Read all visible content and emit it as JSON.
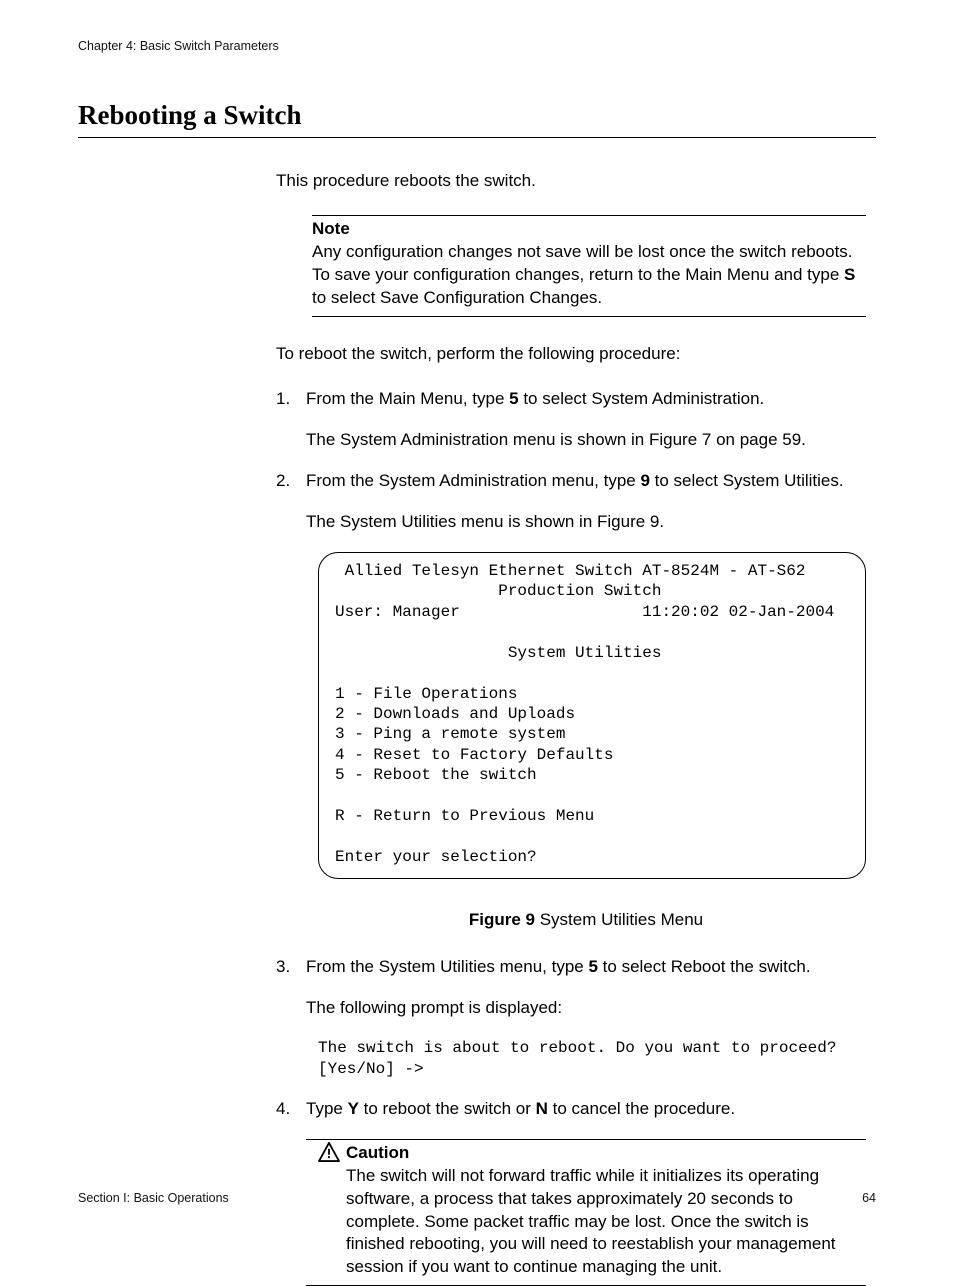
{
  "header": {
    "chapter": "Chapter 4: Basic Switch Parameters"
  },
  "title": "Rebooting a Switch",
  "intro": "This procedure reboots the switch.",
  "note": {
    "label": "Note",
    "line1": "Any configuration changes not save will be lost once the switch reboots. To save your configuration changes, return to the Main Menu and type ",
    "bold": "S",
    "line2": " to select Save Configuration Changes."
  },
  "lead": "To reboot the switch, perform the following procedure:",
  "step1": {
    "num": "1.",
    "pre": "From the Main Menu, type ",
    "bold": "5",
    "post": " to select System Administration.",
    "sub": "The System Administration menu is shown in Figure 7 on page 59."
  },
  "step2": {
    "num": "2.",
    "pre": "From the System Administration menu, type ",
    "bold": "9",
    "post": " to select System Utilities.",
    "sub": "The System Utilities menu is shown in Figure 9."
  },
  "terminal": {
    "l1": " Allied Telesyn Ethernet Switch AT-8524M - AT-S62",
    "l2": "                 Production Switch",
    "l3": "User: Manager                   11:20:02 02-Jan-2004",
    "l4": "",
    "l5": "                  System Utilities",
    "l6": "",
    "l7": "1 - File Operations",
    "l8": "2 - Downloads and Uploads",
    "l9": "3 - Ping a remote system",
    "l10": "4 - Reset to Factory Defaults",
    "l11": "5 - Reboot the switch",
    "l12": "",
    "l13": "R - Return to Previous Menu",
    "l14": "",
    "l15": "Enter your selection?"
  },
  "figure": {
    "label": "Figure 9",
    "caption": "  System Utilities Menu"
  },
  "step3": {
    "num": "3.",
    "pre": "From the System Utilities menu, type ",
    "bold": "5",
    "post": " to select Reboot the switch.",
    "sub": "The following prompt is displayed:"
  },
  "prompt": "The switch is about to reboot. Do you want to proceed? [Yes/No] ->",
  "step4": {
    "num": "4.",
    "pre": "Type ",
    "bold1": "Y",
    "mid": " to reboot the switch or ",
    "bold2": "N",
    "post": " to cancel the procedure."
  },
  "caution": {
    "label": "Caution",
    "text": "The switch will not forward traffic while it initializes its operating software, a process that takes approximately 20 seconds to complete. Some packet traffic may be lost. Once the switch is finished rebooting, you will need to reestablish your management session if you want to continue managing the unit."
  },
  "footer": {
    "left": "Section I: Basic Operations",
    "right": "64"
  }
}
